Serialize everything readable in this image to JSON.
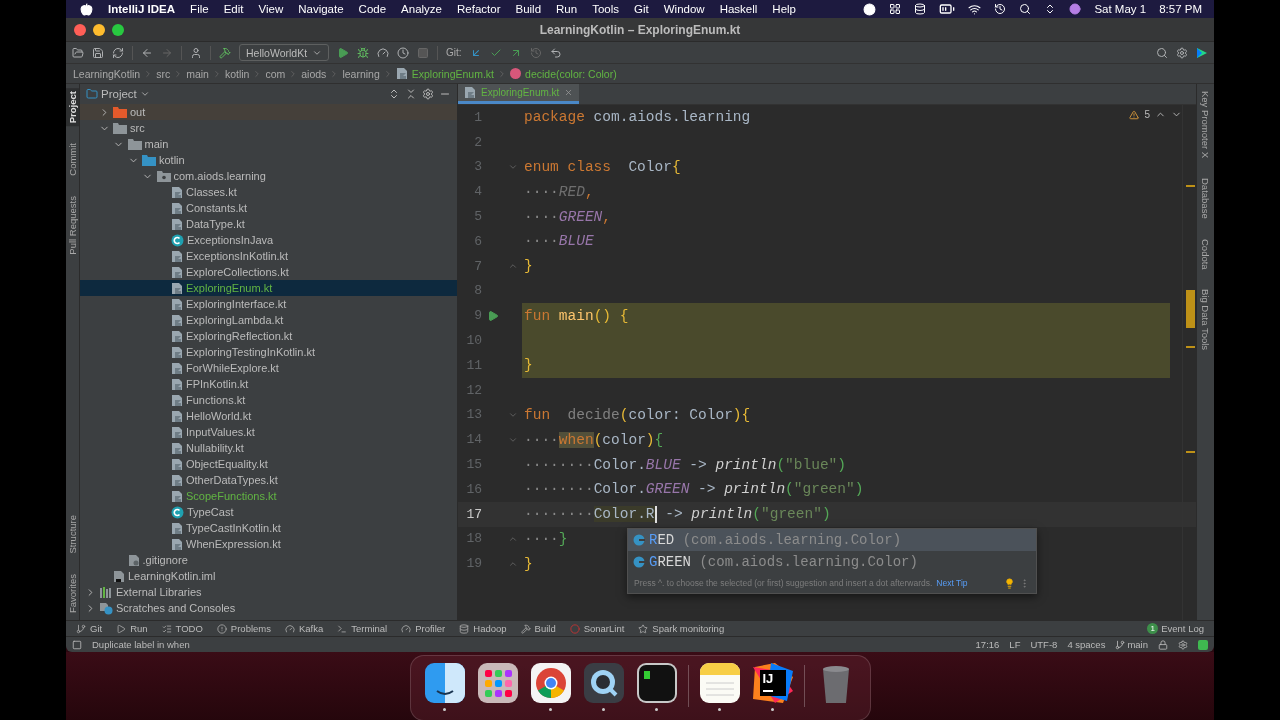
{
  "menubar": {
    "app": "IntelliJ IDEA",
    "menus": [
      "File",
      "Edit",
      "View",
      "Navigate",
      "Code",
      "Analyze",
      "Refactor",
      "Build",
      "Run",
      "Tools",
      "Git",
      "Window",
      "Haskell",
      "Help"
    ],
    "date": "Sat May 1",
    "time": "8:57 PM"
  },
  "window": {
    "title": "LearningKotlin – ExploringEnum.kt"
  },
  "toolbar": {
    "run_config": "HelloWorldKt",
    "git_label": "Git:"
  },
  "breadcrumbs": [
    {
      "label": "LearningKotlin",
      "kind": "folder"
    },
    {
      "label": "src",
      "kind": "folder"
    },
    {
      "label": "main",
      "kind": "folder"
    },
    {
      "label": "kotlin",
      "kind": "folder"
    },
    {
      "label": "com",
      "kind": "folder"
    },
    {
      "label": "aiods",
      "kind": "folder"
    },
    {
      "label": "learning",
      "kind": "folder"
    },
    {
      "label": "ExploringEnum.kt",
      "kind": "file"
    },
    {
      "label": "decide(color: Color)",
      "kind": "function"
    }
  ],
  "left_strip_top": [
    {
      "label": "Project",
      "selected": true
    },
    {
      "label": "Commit",
      "selected": false
    },
    {
      "label": "Pull Requests",
      "selected": false
    }
  ],
  "left_strip_bottom": [
    {
      "label": "Structure",
      "selected": false
    },
    {
      "label": "Favorites",
      "selected": false
    }
  ],
  "project": {
    "title": "Project",
    "tree": [
      {
        "label": "out",
        "kind": "excluded",
        "expanded": false,
        "selected": false,
        "changed": false
      },
      {
        "label": "src",
        "kind": "folder",
        "expanded": true,
        "selected": false,
        "changed": false,
        "children": [
          {
            "label": "main",
            "kind": "folder",
            "expanded": true,
            "selected": false,
            "changed": false,
            "children": [
              {
                "label": "kotlin",
                "kind": "source",
                "expanded": true,
                "selected": false,
                "changed": false,
                "children": [
                  {
                    "label": "com.aiods.learning",
                    "kind": "package",
                    "expanded": true,
                    "selected": false,
                    "changed": false,
                    "children": [
                      {
                        "label": "Classes.kt",
                        "kind": "kotlin",
                        "selected": false,
                        "changed": false
                      },
                      {
                        "label": "Constants.kt",
                        "kind": "kotlin",
                        "selected": false,
                        "changed": false
                      },
                      {
                        "label": "DataType.kt",
                        "kind": "kotlin",
                        "selected": false,
                        "changed": false
                      },
                      {
                        "label": "ExceptionsInJava",
                        "kind": "java",
                        "selected": false,
                        "changed": false
                      },
                      {
                        "label": "ExceptionsInKotlin.kt",
                        "kind": "kotlin",
                        "selected": false,
                        "changed": false
                      },
                      {
                        "label": "ExploreCollections.kt",
                        "kind": "kotlin",
                        "selected": false,
                        "changed": false
                      },
                      {
                        "label": "ExploringEnum.kt",
                        "kind": "kotlin",
                        "selected": true,
                        "changed": true
                      },
                      {
                        "label": "ExploringInterface.kt",
                        "kind": "kotlin",
                        "selected": false,
                        "changed": false
                      },
                      {
                        "label": "ExploringLambda.kt",
                        "kind": "kotlin",
                        "selected": false,
                        "changed": false
                      },
                      {
                        "label": "ExploringReflection.kt",
                        "kind": "kotlin",
                        "selected": false,
                        "changed": false
                      },
                      {
                        "label": "ExploringTestingInKotlin.kt",
                        "kind": "kotlin",
                        "selected": false,
                        "changed": false
                      },
                      {
                        "label": "ForWhileExplore.kt",
                        "kind": "kotlin",
                        "selected": false,
                        "changed": false
                      },
                      {
                        "label": "FPInKotlin.kt",
                        "kind": "kotlin",
                        "selected": false,
                        "changed": false
                      },
                      {
                        "label": "Functions.kt",
                        "kind": "kotlin",
                        "selected": false,
                        "changed": false
                      },
                      {
                        "label": "HelloWorld.kt",
                        "kind": "kotlin",
                        "selected": false,
                        "changed": false
                      },
                      {
                        "label": "InputValues.kt",
                        "kind": "kotlin",
                        "selected": false,
                        "changed": false
                      },
                      {
                        "label": "Nullability.kt",
                        "kind": "kotlin",
                        "selected": false,
                        "changed": false
                      },
                      {
                        "label": "ObjectEquality.kt",
                        "kind": "kotlin",
                        "selected": false,
                        "changed": false
                      },
                      {
                        "label": "OtherDataTypes.kt",
                        "kind": "kotlin",
                        "selected": false,
                        "changed": false
                      },
                      {
                        "label": "ScopeFunctions.kt",
                        "kind": "kotlin",
                        "selected": false,
                        "changed": true
                      },
                      {
                        "label": "TypeCast",
                        "kind": "java",
                        "selected": false,
                        "changed": false
                      },
                      {
                        "label": "TypeCastInKotlin.kt",
                        "kind": "kotlin",
                        "selected": false,
                        "changed": false
                      },
                      {
                        "label": "WhenExpression.kt",
                        "kind": "kotlin",
                        "selected": false,
                        "changed": false
                      }
                    ]
                  }
                ]
              }
            ]
          },
          {
            "label": ".gitignore",
            "kind": "ignore",
            "selected": false,
            "changed": false
          }
        ]
      },
      {
        "label": "LearningKotlin.iml",
        "kind": "iml",
        "selected": false,
        "changed": false
      }
    ],
    "extra": [
      {
        "label": "External Libraries",
        "kind": "libraries",
        "expanded": false,
        "selected": false
      },
      {
        "label": "Scratches and Consoles",
        "kind": "scratches",
        "expanded": false,
        "selected": false
      }
    ]
  },
  "editor": {
    "tab": {
      "label": "ExploringEnum.kt",
      "selected": true
    },
    "warnings": "5",
    "lines": [
      {
        "number": "1",
        "current": false,
        "highlighted": false,
        "runnable": false,
        "fold_start": false,
        "fold_end": false,
        "tokens": [
          {
            "kind": "kw",
            "text": "package"
          },
          {
            "kind": "txt",
            "text": " com.aiods.learning"
          }
        ]
      },
      {
        "number": "2",
        "current": false,
        "highlighted": false,
        "runnable": false,
        "fold_start": false,
        "fold_end": false
      },
      {
        "number": "3",
        "current": false,
        "highlighted": false,
        "runnable": false,
        "fold_start": true,
        "fold_end": false,
        "tokens": [
          {
            "kind": "kw",
            "text": "enum class"
          },
          {
            "kind": "txt",
            "text": "  Color"
          },
          {
            "kind": "b1",
            "text": "{"
          }
        ]
      },
      {
        "number": "4",
        "current": false,
        "highlighted": false,
        "runnable": false,
        "fold_start": false,
        "fold_end": false,
        "tokens": [
          {
            "kind": "ws",
            "text": "····"
          },
          {
            "kind": "unused_enum",
            "text": "RED"
          },
          {
            "kind": "kw",
            "text": ","
          }
        ]
      },
      {
        "number": "5",
        "current": false,
        "highlighted": false,
        "runnable": false,
        "fold_start": false,
        "fold_end": false,
        "tokens": [
          {
            "kind": "ws",
            "text": "····"
          },
          {
            "kind": "enum",
            "text": "GREEN"
          },
          {
            "kind": "kw",
            "text": ","
          }
        ]
      },
      {
        "number": "6",
        "current": false,
        "highlighted": false,
        "runnable": false,
        "fold_start": false,
        "fold_end": false,
        "tokens": [
          {
            "kind": "ws",
            "text": "····"
          },
          {
            "kind": "enum",
            "text": "BLUE"
          }
        ]
      },
      {
        "number": "7",
        "current": false,
        "highlighted": false,
        "runnable": false,
        "fold_start": false,
        "fold_end": true,
        "tokens": [
          {
            "kind": "b1",
            "text": "}"
          }
        ]
      },
      {
        "number": "8",
        "current": false,
        "highlighted": false,
        "runnable": false,
        "fold_start": false,
        "fold_end": false
      },
      {
        "number": "9",
        "current": false,
        "highlighted": true,
        "runnable": true,
        "fold_start": false,
        "fold_end": false,
        "tokens": [
          {
            "kind": "kw",
            "text": "fun "
          },
          {
            "kind": "fn",
            "text": "main"
          },
          {
            "kind": "b1",
            "text": "() {"
          }
        ]
      },
      {
        "number": "10",
        "current": false,
        "highlighted": true,
        "runnable": false,
        "fold_start": false,
        "fold_end": false
      },
      {
        "number": "11",
        "current": false,
        "highlighted": true,
        "runnable": false,
        "fold_start": false,
        "fold_end": false,
        "tokens": [
          {
            "kind": "b1",
            "text": "}"
          }
        ]
      },
      {
        "number": "12",
        "current": false,
        "highlighted": false,
        "runnable": false,
        "fold_start": false,
        "fold_end": false
      },
      {
        "number": "13",
        "current": false,
        "highlighted": false,
        "runnable": false,
        "fold_start": true,
        "fold_end": false,
        "tokens": [
          {
            "kind": "kw",
            "text": "fun"
          },
          {
            "kind": "unused_fn",
            "text": "  decide"
          },
          {
            "kind": "b1",
            "text": "("
          },
          {
            "kind": "txt",
            "text": "color: Color"
          },
          {
            "kind": "b1",
            "text": ")"
          },
          {
            "kind": "b1",
            "text": "{"
          }
        ]
      },
      {
        "number": "14",
        "current": false,
        "highlighted": false,
        "runnable": false,
        "fold_start": true,
        "fold_end": false,
        "tokens": [
          {
            "kind": "ws",
            "text": "····"
          },
          {
            "kind": "kw_marked",
            "text": "when"
          },
          {
            "kind": "b1",
            "text": "("
          },
          {
            "kind": "txt",
            "text": "color"
          },
          {
            "kind": "b1",
            "text": ")"
          },
          {
            "kind": "b2",
            "text": "{"
          }
        ]
      },
      {
        "number": "15",
        "current": false,
        "highlighted": false,
        "runnable": false,
        "fold_start": false,
        "fold_end": false,
        "tokens": [
          {
            "kind": "ws",
            "text": "········"
          },
          {
            "kind": "txt",
            "text": "Color."
          },
          {
            "kind": "enum",
            "text": "BLUE"
          },
          {
            "kind": "txt",
            "text": " -> "
          },
          {
            "kind": "call",
            "text": "println"
          },
          {
            "kind": "b2",
            "text": "("
          },
          {
            "kind": "str",
            "text": "\"blue\""
          },
          {
            "kind": "b2",
            "text": ")"
          }
        ]
      },
      {
        "number": "16",
        "current": false,
        "highlighted": false,
        "runnable": false,
        "fold_start": false,
        "fold_end": false,
        "tokens": [
          {
            "kind": "ws",
            "text": "········"
          },
          {
            "kind": "txt",
            "text": "Color."
          },
          {
            "kind": "enum",
            "text": "GREEN"
          },
          {
            "kind": "txt",
            "text": " -> "
          },
          {
            "kind": "call",
            "text": "println"
          },
          {
            "kind": "b2",
            "text": "("
          },
          {
            "kind": "str",
            "text": "\"green\""
          },
          {
            "kind": "b2",
            "text": ")"
          }
        ]
      },
      {
        "number": "17",
        "current": true,
        "highlighted": false,
        "runnable": false,
        "fold_start": false,
        "fold_end": false,
        "tokens": [
          {
            "kind": "ws",
            "text": "········"
          },
          {
            "kind": "txt_marked",
            "text": "Color.R"
          },
          {
            "kind": "txt",
            "text": " -> "
          },
          {
            "kind": "call",
            "text": "println"
          },
          {
            "kind": "b2",
            "text": "("
          },
          {
            "kind": "str",
            "text": "\"green\""
          },
          {
            "kind": "b2",
            "text": ")"
          }
        ]
      },
      {
        "number": "18",
        "current": false,
        "highlighted": false,
        "runnable": false,
        "fold_start": false,
        "fold_end": true,
        "tokens": [
          {
            "kind": "ws",
            "text": "····"
          },
          {
            "kind": "b2",
            "text": "}"
          }
        ]
      },
      {
        "number": "19",
        "current": false,
        "highlighted": false,
        "runnable": false,
        "fold_start": false,
        "fold_end": true,
        "tokens": [
          {
            "kind": "b1",
            "text": "}"
          }
        ]
      }
    ],
    "completion": {
      "items": [
        {
          "match": "R",
          "rest": "ED",
          "detail": "(com.aiods.learning.Color)",
          "selected": true
        },
        {
          "match": "G",
          "rest": "REEN",
          "detail": "(com.aiods.learning.Color)",
          "selected": false
        }
      ],
      "hint": "Press ^. to choose the selected (or first) suggestion and insert a dot afterwards.",
      "link": "Next Tip"
    }
  },
  "right_strip": [
    "Key Promoter X",
    "Database",
    "Codota",
    "Big Data Tools"
  ],
  "tool_windows": [
    {
      "label": "Git",
      "kind": "git"
    },
    {
      "label": "Run",
      "kind": "run"
    },
    {
      "label": "TODO",
      "kind": "todo"
    },
    {
      "label": "Problems",
      "kind": "problems"
    },
    {
      "label": "Kafka",
      "kind": "kafka"
    },
    {
      "label": "Terminal",
      "kind": "terminal"
    },
    {
      "label": "Profiler",
      "kind": "profiler"
    },
    {
      "label": "Hadoop",
      "kind": "hadoop"
    },
    {
      "label": "Build",
      "kind": "build"
    },
    {
      "label": "SonarLint",
      "kind": "sonar"
    },
    {
      "label": "Spark monitoring",
      "kind": "spark"
    }
  ],
  "event_log": {
    "label": "Event Log",
    "count": "1"
  },
  "status": {
    "message": "Duplicate label in when",
    "position": "17:16",
    "line_sep": "LF",
    "encoding": "UTF-8",
    "indent": "4 spaces",
    "branch": "main"
  },
  "dock": [
    {
      "kind": "finder",
      "running": true
    },
    {
      "kind": "launchpad",
      "running": false
    },
    {
      "kind": "chrome",
      "running": true
    },
    {
      "kind": "quicktime",
      "running": true
    },
    {
      "kind": "terminal",
      "running": true
    },
    {
      "kind": "separator"
    },
    {
      "kind": "notes",
      "running": true
    },
    {
      "kind": "intellij",
      "running": true,
      "text": "IJ"
    },
    {
      "kind": "separator"
    },
    {
      "kind": "trash",
      "running": false
    }
  ]
}
